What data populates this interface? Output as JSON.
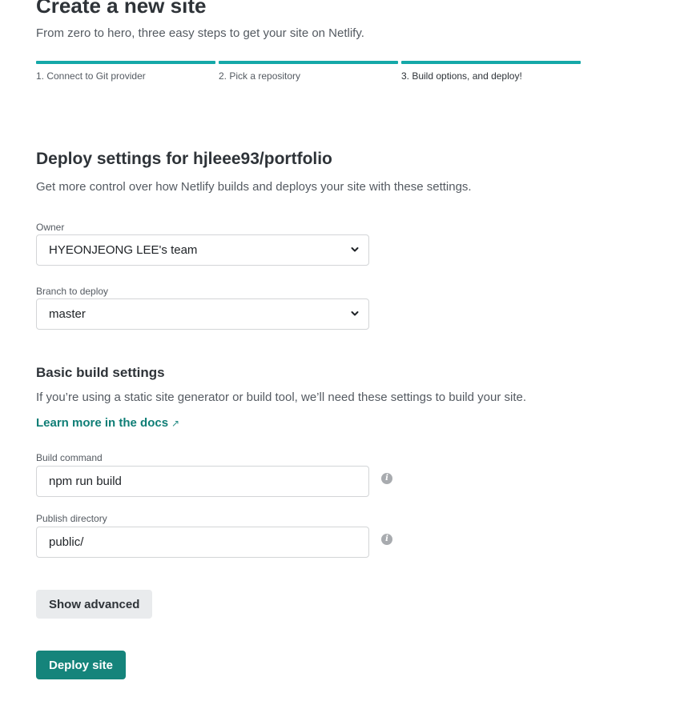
{
  "header": {
    "title": "Create a new site",
    "subtitle": "From zero to hero, three easy steps to get your site on Netlify."
  },
  "steps": [
    {
      "label": "1. Connect to Git provider",
      "state": "complete"
    },
    {
      "label": "2. Pick a repository",
      "state": "complete"
    },
    {
      "label": "3. Build options, and deploy!",
      "state": "current"
    }
  ],
  "deploy_settings": {
    "title": "Deploy settings for hjleee93/portfolio",
    "description": "Get more control over how Netlify builds and deploys your site with these settings."
  },
  "owner": {
    "label": "Owner",
    "value": "HYEONJEONG LEE's team"
  },
  "branch": {
    "label": "Branch to deploy",
    "value": "master"
  },
  "build_settings": {
    "title": "Basic build settings",
    "description": "If you’re using a static site generator or build tool, we’ll need these settings to build your site.",
    "docs_link": "Learn more in the docs",
    "docs_link_icon": "↗"
  },
  "build_command": {
    "label": "Build command",
    "value": "npm run build",
    "info_icon": "info-icon"
  },
  "publish_directory": {
    "label": "Publish directory",
    "value": "public/",
    "info_icon": "info-icon"
  },
  "buttons": {
    "show_advanced": "Show advanced",
    "deploy": "Deploy site"
  },
  "colors": {
    "accent": "#15a8a8",
    "primary_button": "#15847b",
    "link": "#0f7e76"
  }
}
